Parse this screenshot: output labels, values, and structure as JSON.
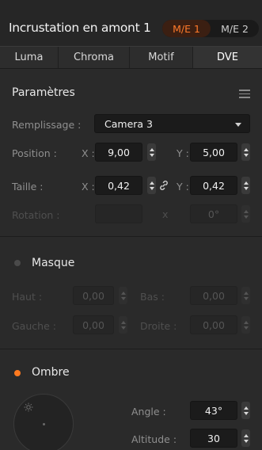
{
  "header": {
    "title": "Incrustation en amont 1",
    "me_buttons": [
      {
        "label": "M/E 1",
        "active": true
      },
      {
        "label": "M/E 2",
        "active": false
      }
    ]
  },
  "tabs": [
    {
      "label": "Luma",
      "active": false
    },
    {
      "label": "Chroma",
      "active": false
    },
    {
      "label": "Motif",
      "active": false
    },
    {
      "label": "DVE",
      "active": true
    }
  ],
  "parametres": {
    "title": "Paramètres",
    "fill_label": "Remplissage :",
    "fill_value": "Camera 3",
    "position_label": "Position :",
    "position_x_label": "X :",
    "position_x": "9,00",
    "position_y_label": "Y :",
    "position_y": "5,00",
    "size_label": "Taille :",
    "size_x_label": "X :",
    "size_x": "0,42",
    "size_y_label": "Y :",
    "size_y": "0,42",
    "rotation_label": "Rotation :",
    "rotation_x_label": "x",
    "rotation_value": "0°"
  },
  "masque": {
    "title": "Masque",
    "enabled": false,
    "top_label": "Haut :",
    "top_value": "0,00",
    "bottom_label": "Bas :",
    "bottom_value": "0,00",
    "left_label": "Gauche :",
    "left_value": "0,00",
    "right_label": "Droite :",
    "right_value": "0,00"
  },
  "ombre": {
    "title": "Ombre",
    "enabled": true,
    "angle_label": "Angle :",
    "angle_value": "43°",
    "altitude_label": "Altitude :",
    "altitude_value": "30"
  },
  "colors": {
    "accent": "#ff7a1f",
    "background": "#2b2b2b",
    "field": "#1b1b1b"
  }
}
